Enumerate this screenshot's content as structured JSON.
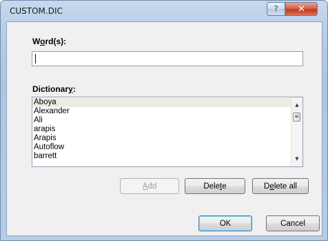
{
  "window": {
    "title": "CUSTOM.DIC",
    "help_glyph": "?",
    "close_glyph": "✕"
  },
  "words": {
    "label_pre": "W",
    "label_accel": "o",
    "label_post": "rd(s):",
    "value": ""
  },
  "dictionary": {
    "label_pre": "Dictionar",
    "label_accel": "y",
    "label_post": ":",
    "items": [
      "Aboya",
      "Alexander",
      "Ali",
      "arapis",
      "Arapis",
      "Autoflow",
      "barrett"
    ],
    "selected_index": 0
  },
  "buttons": {
    "add": {
      "pre": "",
      "accel": "A",
      "post": "dd"
    },
    "delete": {
      "pre": "Dele",
      "accel": "t",
      "post": "e"
    },
    "delete_all": {
      "pre": "D",
      "accel": "e",
      "post": "lete all"
    },
    "ok": "OK",
    "cancel": "Cancel"
  }
}
